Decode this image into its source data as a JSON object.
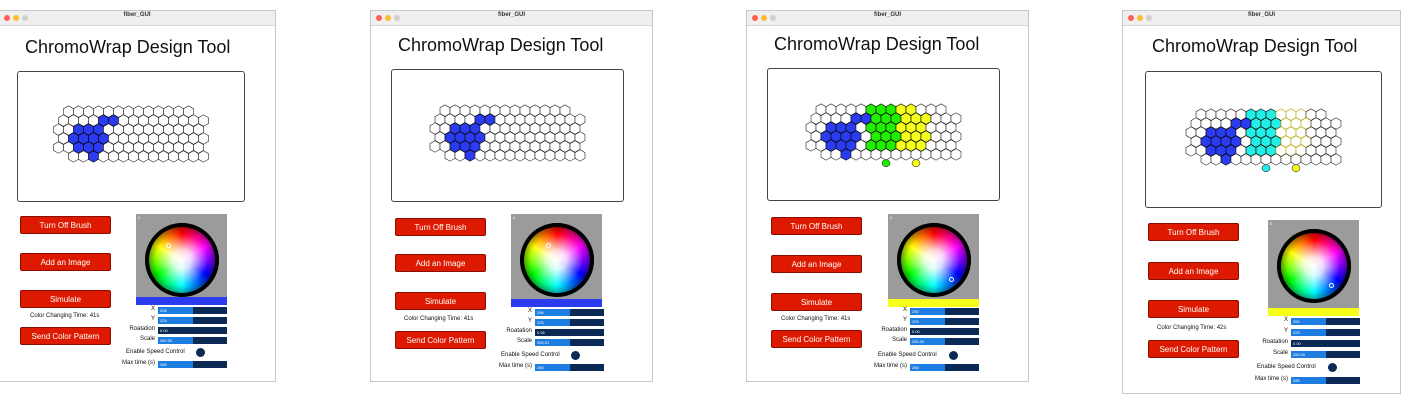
{
  "window_title": "fiber_GUI",
  "app_title": "ChromoWrap Design Tool",
  "buttons": {
    "brush": "Turn Off Brush",
    "image": "Add an Image",
    "simulate": "Simulate",
    "send": "Send Color Pattern"
  },
  "labels": {
    "x": "X",
    "y": "Y",
    "rotation": "Roatation",
    "scale": "Scale",
    "speed": "Enable Speed Control",
    "maxtime": "Max time (s)"
  },
  "picker_index": "0",
  "colors": {
    "blue": "#2b3cf0",
    "green": "#22ee00",
    "yellow": "#f5ff1a",
    "cyan": "#22f0e6",
    "accent_red": "#dd1a00"
  },
  "windows": [
    {
      "color_time": "Color Changing Time: 41s",
      "swatch": "#2b3cf0",
      "sliders": {
        "x": "296",
        "y": "225",
        "rotation": "0.00",
        "scale": "260.00",
        "maxtime": "285"
      },
      "slider_levels": [
        0.5,
        0.5,
        0.0,
        0.5,
        0.5
      ],
      "marker": [
        0.32,
        0.3
      ],
      "regions": [
        "blue"
      ]
    },
    {
      "color_time": "Color Changing Time: 41s",
      "swatch": "#2b3cf0",
      "sliders": {
        "x": "296",
        "y": "225",
        "rotation": "0.06",
        "scale": "260.01",
        "maxtime": "285"
      },
      "slider_levels": [
        0.5,
        0.5,
        0.0,
        0.5,
        0.5
      ],
      "marker": [
        0.38,
        0.3
      ],
      "regions": [
        "blue"
      ]
    },
    {
      "color_time": "Color Changing Time: 41s",
      "swatch": "#f5ff1a",
      "sliders": {
        "x": "250",
        "y": "225",
        "rotation": "0.00",
        "scale": "250.00",
        "maxtime": "285"
      },
      "slider_levels": [
        0.5,
        0.5,
        0.0,
        0.5,
        0.5
      ],
      "marker": [
        0.74,
        0.76
      ],
      "regions": [
        "blue",
        "green",
        "yellow"
      ]
    },
    {
      "color_time": "Color Changing Time: 42s",
      "swatch": "#f5ff1a",
      "sliders": {
        "x": "250",
        "y": "225",
        "rotation": "0.00",
        "scale": "250.00",
        "maxtime": "285"
      },
      "slider_levels": [
        0.5,
        0.5,
        0.0,
        0.5,
        0.5
      ],
      "marker": [
        0.74,
        0.76
      ],
      "regions": [
        "blue",
        "cyan",
        "yellow-outline"
      ]
    }
  ]
}
